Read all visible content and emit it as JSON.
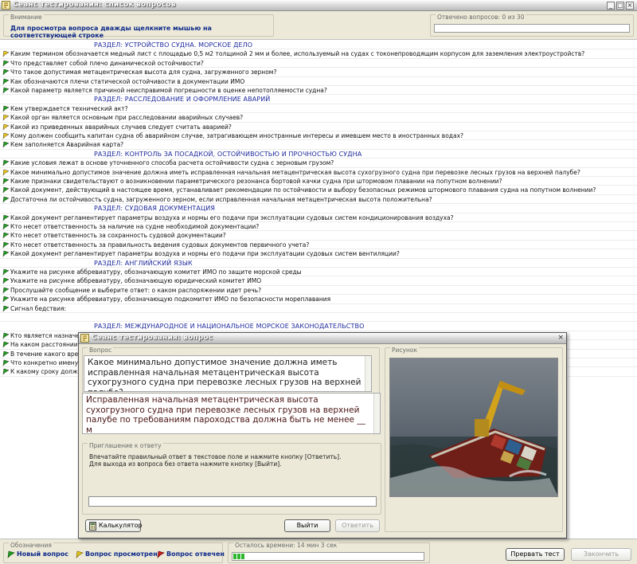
{
  "window": {
    "title": "Сеанс тестирования: список вопросов",
    "controls": [
      "_",
      "□",
      "×"
    ]
  },
  "attention": {
    "label": "Внимание",
    "text": "Для просмотра вопроса дважды щелкните мышью на соответствующей строке"
  },
  "answered": {
    "text": "Отвечено вопросов: 0 из 30",
    "progress": 0
  },
  "list": [
    {
      "type": "section",
      "text": "РАЗДЕЛ: УСТРОЙСТВО СУДНА. МОРСКОЕ ДЕЛО"
    },
    {
      "type": "q",
      "flag": "viewed",
      "text": "Каким термином обозначается медный лист с площадью 0,5 м2 толщиной 2 мм и более, используемый на судах с токонепроводящим корпусом для заземления электроустройств?"
    },
    {
      "type": "q",
      "flag": "new",
      "text": "Что представляет собой плечо динамической остойчивости?"
    },
    {
      "type": "q",
      "flag": "new",
      "text": "Что такое допустимая метацентрическая высота для судна, загруженного зерном?"
    },
    {
      "type": "q",
      "flag": "new",
      "text": "Как обозначаются плечи статической остойчивости в документации ИМО"
    },
    {
      "type": "q",
      "flag": "new",
      "text": "Какой параметр является причиной неисправимой погрешности в оценке непотопляемости судна?"
    },
    {
      "type": "section",
      "text": "РАЗДЕЛ: РАССЛЕДОВАНИЕ И ОФОРМЛЕНИЕ АВАРИЙ"
    },
    {
      "type": "q",
      "flag": "new",
      "text": "Кем утверждается технический акт?"
    },
    {
      "type": "q",
      "flag": "viewed",
      "text": "Какой орган является основным при расследовании аварийных случаев?"
    },
    {
      "type": "q",
      "flag": "viewed",
      "text": "Какой из приведенных аварийных случаев следует считать аварией?"
    },
    {
      "type": "q",
      "flag": "viewed",
      "text": "Кому должен сообщить капитан судна об аварийном случае, затрагивающем иностранные интересы и имевшем место в иностранных водах?"
    },
    {
      "type": "q",
      "flag": "new",
      "text": "Кем заполняется Аварийная карта?"
    },
    {
      "type": "section",
      "text": "РАЗДЕЛ: КОНТРОЛЬ ЗА ПОСАДКОЙ, ОСТОЙЧИВОСТЬЮ И ПРОЧНОСТЬЮ СУДНА"
    },
    {
      "type": "q",
      "flag": "new",
      "text": "Какие условия лежат в основе уточненного способа расчета остойчивости судна с зерновым грузом?"
    },
    {
      "type": "q",
      "flag": "viewed",
      "text": "Какое минимально допустимое значение должна иметь исправленная начальная метацентрическая высота сухогрузного судна при перевозке лесных грузов на верхней палубе?"
    },
    {
      "type": "q",
      "flag": "new",
      "text": "Какие признаки свидетельствуют о возникновении параметрического резонанса бортовой качки судна при штормовом плавании на попутном волнении?"
    },
    {
      "type": "q",
      "flag": "new",
      "text": "Какой документ, действующий в настоящее время, устанавливает рекомендации по остойчивости и выбору безопасных режимов штормового плавания судна на попутном волнении?"
    },
    {
      "type": "q",
      "flag": "new",
      "text": "Достаточна ли остойчивость судна, загруженного зерном, если исправленная начальная метацентрическая высота положительна?"
    },
    {
      "type": "section",
      "text": "РАЗДЕЛ: СУДОВАЯ ДОКУМЕНТАЦИЯ"
    },
    {
      "type": "q",
      "flag": "new",
      "text": "Какой документ регламентирует параметры воздуха и нормы его подачи при эксплуатации судовых систем кондиционирования воздуха?"
    },
    {
      "type": "q",
      "flag": "new",
      "text": "Кто несет ответственность за наличие на судне необходимой документации?"
    },
    {
      "type": "q",
      "flag": "new",
      "text": "Кто несет ответственность за сохранность судовой документации?"
    },
    {
      "type": "q",
      "flag": "new",
      "text": "Кто несет ответственность за правильность ведения судовых документов первичного учета?"
    },
    {
      "type": "q",
      "flag": "new",
      "text": "Какой документ регламентирует параметры воздуха и нормы его подачи при эксплуатации судовых систем вентиляции?"
    },
    {
      "type": "section",
      "text": "РАЗДЕЛ: АНГЛИЙСКИЙ ЯЗЫК"
    },
    {
      "type": "q",
      "flag": "new",
      "text": "Укажите на рисунке аббревиатуру, обозначающую комитет ИМО по защите морской среды"
    },
    {
      "type": "q",
      "flag": "new",
      "text": "Укажите на рисунке аббревиатуру, обозначающую юридический комитет ИМО"
    },
    {
      "type": "q",
      "flag": "new",
      "text": "Прослушайте сообщение и выберите ответ: о каком распоряжении идет речь?"
    },
    {
      "type": "q",
      "flag": "new",
      "text": "Укажите на рисунке аббревиатуру, обозначающую подкомитет ИМО по безопасности мореплавания"
    },
    {
      "type": "q",
      "flag": "new",
      "text": "Сигнал бедствия:"
    },
    {
      "type": "blank",
      "text": ""
    },
    {
      "type": "section",
      "text": "РАЗДЕЛ: МЕЖДУНАРОДНОЕ И НАЦИОНАЛЬНОЕ МОРСКОЕ ЗАКОНОДАТЕЛЬСТВО"
    },
    {
      "type": "q",
      "flag": "new",
      "text": "Кто является назначен"
    },
    {
      "type": "q",
      "flag": "new",
      "text": "На каком расстоянии о"
    },
    {
      "type": "q",
      "flag": "new",
      "text": "В течение какого врем"
    },
    {
      "type": "q",
      "flag": "new",
      "text": "Что конкретно именуем"
    },
    {
      "type": "q",
      "flag": "new",
      "text": "К какому сроку должны"
    }
  ],
  "legend": {
    "label": "Обозначения",
    "new": "Новый вопрос",
    "viewed": "Вопрос просмотрен",
    "answered": "Вопрос отвечен"
  },
  "time": {
    "text": "Осталось времени: 14 мин 3 сек",
    "progress": 0.06
  },
  "buttons": {
    "abort": "Прервать тест",
    "finish": "Закончить"
  },
  "dialog": {
    "title": "Сеанс тестирования: вопрос",
    "close": "×",
    "question_label": "Вопрос",
    "question": "Какое минимально допустимое значение должна иметь исправленная начальная метацентрическая высота сухогрузного судна при перевозке лесных грузов на верхней палубе?",
    "answer_prompt": "Исправленная начальная метацентрическая высота сухогрузного судна при перевозке лесных грузов на верхней палубе по требованиям пароходства должна быть не менее __ м",
    "invite_label": "Приглашение к ответу",
    "instruction1": "Впечатайте правильный ответ в текстовое поле и нажмите кнопку [Ответить].",
    "instruction2": "Для выхода из вопроса без ответа нажмите кнопку [Выйти].",
    "answer_value": "",
    "picture_label": "Рисунок",
    "calc_button": "Калькулятор",
    "exit_button": "Выйти",
    "answer_button": "Ответить"
  },
  "colors": {
    "section_text": "#1e2a9b",
    "hint_text": "#0d2a8a",
    "flag_new": "#1f9a1f",
    "flag_viewed": "#e4c21a",
    "flag_answered": "#c61f1f"
  }
}
